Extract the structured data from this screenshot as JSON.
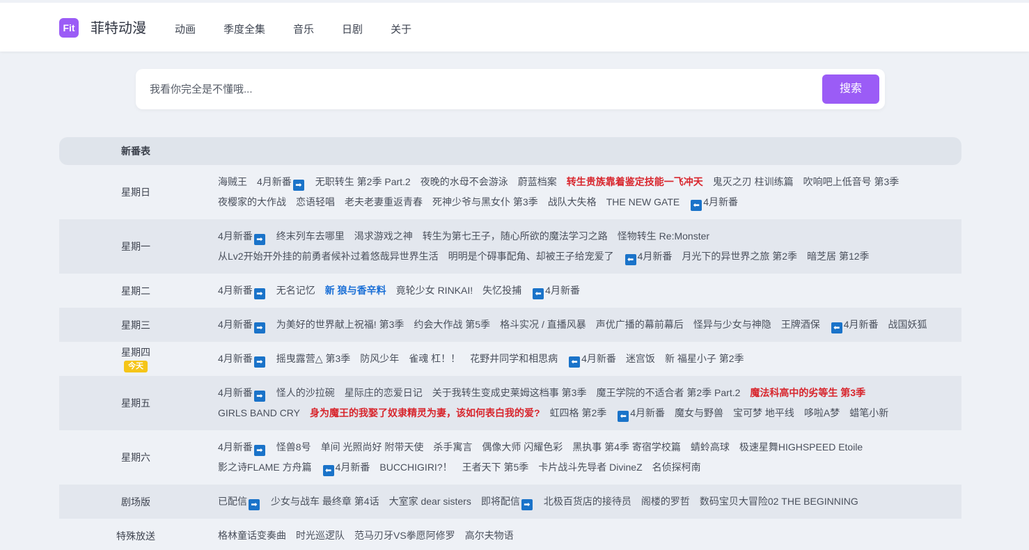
{
  "header": {
    "logo_text": "Fit",
    "site_name": "菲特动漫",
    "nav": [
      "动画",
      "季度全集",
      "音乐",
      "日剧",
      "关于"
    ]
  },
  "search": {
    "placeholder": "我看你完全是不懂哦...",
    "button_label": "搜索"
  },
  "schedule": {
    "title": "新番表",
    "today_badge": "今天",
    "arrow_right_glyph": "➡",
    "arrow_left_glyph": "⬅",
    "rows": [
      {
        "day": "星期日",
        "items": [
          {
            "text": "海贼王"
          },
          {
            "text": "4月新番",
            "arrow": "right"
          },
          {
            "text": "无职转生 第2季 Part.2"
          },
          {
            "text": "夜晚的水母不会游泳"
          },
          {
            "text": "蔚蓝档案"
          },
          {
            "text": "转生贵族靠着鉴定技能一飞冲天",
            "style": "red"
          },
          {
            "text": "鬼灭之刃 柱训练篇"
          },
          {
            "text": "吹响吧上低音号 第3季"
          },
          {
            "text": "夜樱家的大作战"
          },
          {
            "text": "恋语轻唱"
          },
          {
            "text": "老夫老妻重返青春"
          },
          {
            "text": "死神少爷与黑女仆 第3季"
          },
          {
            "text": "战队大失格"
          },
          {
            "text": "THE NEW GATE"
          },
          {
            "text": "4月新番",
            "arrow": "left"
          }
        ]
      },
      {
        "day": "星期一",
        "items": [
          {
            "text": "4月新番",
            "arrow": "right"
          },
          {
            "text": "终末列车去哪里"
          },
          {
            "text": "渴求游戏之神"
          },
          {
            "text": "转生为第七王子，随心所欲的魔法学习之路"
          },
          {
            "text": "怪物转生 Re:Monster"
          },
          {
            "text": "从Lv2开始开外挂的前勇者候补过着悠哉异世界生活"
          },
          {
            "text": "明明是个碍事配角、却被王子给宠爱了"
          },
          {
            "text": "4月新番",
            "arrow": "left"
          },
          {
            "text": "月光下的异世界之旅 第2季"
          },
          {
            "text": "暗芝居 第12季"
          }
        ]
      },
      {
        "day": "星期二",
        "items": [
          {
            "text": "4月新番",
            "arrow": "right"
          },
          {
            "text": "无名记忆"
          },
          {
            "text": "新 狼与香辛料",
            "style": "blue"
          },
          {
            "text": "竟轮少女 RINKAI!"
          },
          {
            "text": "失忆投捕"
          },
          {
            "text": "4月新番",
            "arrow": "left"
          }
        ]
      },
      {
        "day": "星期三",
        "items": [
          {
            "text": "4月新番",
            "arrow": "right"
          },
          {
            "text": "为美好的世界献上祝福! 第3季"
          },
          {
            "text": "约会大作战 第5季"
          },
          {
            "text": "格斗实况 / 直播风暴"
          },
          {
            "text": "声优广播的幕前幕后"
          },
          {
            "text": "怪异与少女与神隐"
          },
          {
            "text": "王牌酒保"
          },
          {
            "text": "4月新番",
            "arrow": "left"
          },
          {
            "text": "战国妖狐"
          }
        ]
      },
      {
        "day": "星期四",
        "today": true,
        "items": [
          {
            "text": "4月新番",
            "arrow": "right"
          },
          {
            "text": "摇曳露营△ 第3季"
          },
          {
            "text": "防风少年"
          },
          {
            "text": "雀魂 杠！！"
          },
          {
            "text": "花野井同学和相思病"
          },
          {
            "text": "4月新番",
            "arrow": "left"
          },
          {
            "text": "迷宫饭"
          },
          {
            "text": "新 福星小子 第2季"
          }
        ]
      },
      {
        "day": "星期五",
        "items": [
          {
            "text": "4月新番",
            "arrow": "right"
          },
          {
            "text": "怪人的沙拉碗"
          },
          {
            "text": "星际庄的恋爱日记"
          },
          {
            "text": "关于我转生变成史莱姆这档事 第3季"
          },
          {
            "text": "魔王学院的不适合者 第2季 Part.2"
          },
          {
            "text": "魔法科高中的劣等生 第3季",
            "style": "red"
          },
          {
            "text": "GIRLS BAND CRY"
          },
          {
            "text": "身为魔王的我娶了奴隶精灵为妻，该如何表白我的爱?",
            "style": "red"
          },
          {
            "text": "虹四格 第2季"
          },
          {
            "text": "4月新番",
            "arrow": "left"
          },
          {
            "text": "魔女与野兽"
          },
          {
            "text": "宝可梦 地平线"
          },
          {
            "text": "哆啦A梦"
          },
          {
            "text": "蜡笔小新"
          }
        ]
      },
      {
        "day": "星期六",
        "items": [
          {
            "text": "4月新番",
            "arrow": "right"
          },
          {
            "text": "怪兽8号"
          },
          {
            "text": "单间 光照尚好 附带天使"
          },
          {
            "text": "杀手寓言"
          },
          {
            "text": "偶像大师 闪耀色彩"
          },
          {
            "text": "黑执事 第4季 寄宿学校篇"
          },
          {
            "text": "蜻蛉高球"
          },
          {
            "text": "极速星舞HIGHSPEED Etoile"
          },
          {
            "text": "影之诗FLAME 方舟篇"
          },
          {
            "text": "4月新番",
            "arrow": "left"
          },
          {
            "text": "BUCCHIGIRI?！"
          },
          {
            "text": "王者天下 第5季"
          },
          {
            "text": "卡片战斗先导者 DivineZ"
          },
          {
            "text": "名侦探柯南"
          }
        ]
      },
      {
        "day": "剧场版",
        "items": [
          {
            "text": "已配信",
            "arrow": "right"
          },
          {
            "text": "少女与战车 最终章 第4话"
          },
          {
            "text": "大室家 dear sisters"
          },
          {
            "text": "即将配信",
            "arrow": "right"
          },
          {
            "text": "北极百货店的接待员"
          },
          {
            "text": "阁楼的罗哲"
          },
          {
            "text": "数码宝贝大冒险02 THE BEGINNING"
          }
        ]
      },
      {
        "day": "特殊放送",
        "items": [
          {
            "text": "格林童话变奏曲"
          },
          {
            "text": "时光巡逻队"
          },
          {
            "text": "范马刃牙VS拳愿阿修罗"
          },
          {
            "text": "高尔夫物语"
          }
        ]
      }
    ]
  },
  "colors": {
    "accent": "#9b5cf6",
    "page_bg": "#eef1f6",
    "highlight_red": "#d8262d",
    "highlight_blue": "#1a6fd6",
    "today_badge": "#f5c518",
    "arrow_icon": "#1a73c9"
  }
}
